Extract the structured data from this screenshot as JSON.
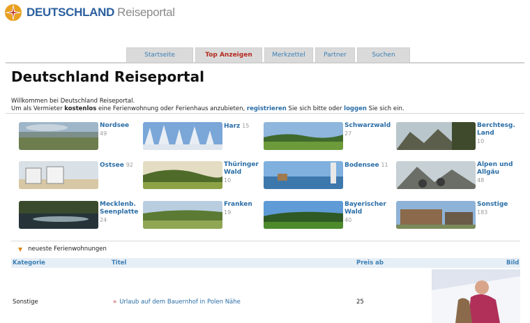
{
  "header": {
    "logo_strong": "DEUTSCHLAND",
    "logo_light": "Reiseportal",
    "colors": {
      "brand": "#2a5f9e",
      "accent": "#e8a020"
    }
  },
  "nav": {
    "tabs": [
      {
        "label": "Startseite",
        "active": false
      },
      {
        "label": "Top Anzeigen",
        "active": true
      },
      {
        "label": "Merkzettel",
        "active": false
      },
      {
        "label": "Partner",
        "active": false
      },
      {
        "label": "Suchen",
        "active": false
      }
    ]
  },
  "page": {
    "title": "Deutschland Reiseportal",
    "intro_line1": "Willkommen bei Deutschland Reiseportal.",
    "intro_l2_a": "Um als Vermieter ",
    "intro_l2_bold": "kostenlos",
    "intro_l2_b": " eine Ferienwohnung oder Ferienhaus anzubieten, ",
    "intro_l2_link1": "registrieren",
    "intro_l2_c": " Sie sich bitte oder ",
    "intro_l2_link2": "loggen",
    "intro_l2_d": " Sie sich ein."
  },
  "regions": [
    {
      "name": "Nordsee",
      "count": "49"
    },
    {
      "name": "Harz",
      "count": "15"
    },
    {
      "name": "Schwarzwald",
      "count": "27"
    },
    {
      "name": "Berchtesg.\nLand",
      "count": "10"
    },
    {
      "name": "Ostsee",
      "count": "92"
    },
    {
      "name": "Thüringer\nWald",
      "count": "10"
    },
    {
      "name": "Bodensee",
      "count": "11"
    },
    {
      "name": "Alpen und\nAllgäu",
      "count": "48"
    },
    {
      "name": "Mecklenb.\nSeenplatte",
      "count": "24"
    },
    {
      "name": "Franken",
      "count": "19"
    },
    {
      "name": "Bayerischer\nWald",
      "count": "40"
    },
    {
      "name": "Sonstige",
      "count": "183"
    }
  ],
  "listings": {
    "heading": "neueste Ferienwohnungen",
    "columns": {
      "category": "Kategorie",
      "title": "Titel",
      "price": "Preis ab",
      "image": "Bild"
    },
    "rows": [
      {
        "category": "Sonstige",
        "title": "Urlaub auf dem Bauernhof in Polen Nähe",
        "price": "25"
      }
    ]
  }
}
